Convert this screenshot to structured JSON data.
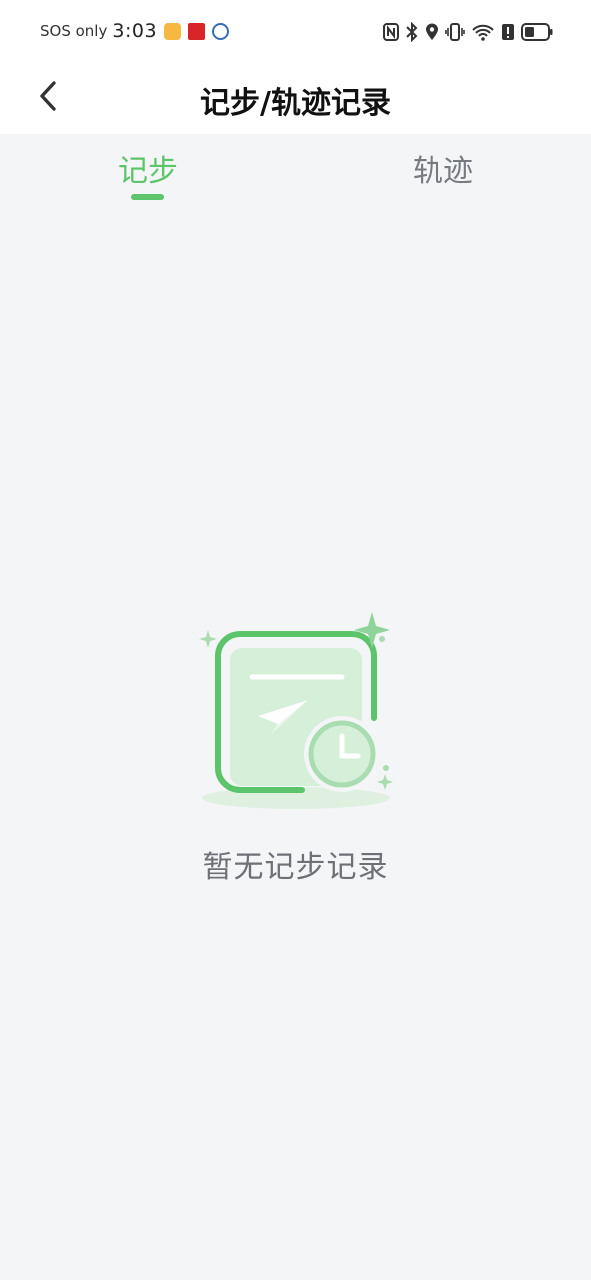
{
  "status_bar": {
    "network_text": "SOS only",
    "time": "3:03",
    "icons": [
      "notes-app-icon",
      "news-app-icon",
      "security-app-icon",
      "nfc-icon",
      "bluetooth-icon",
      "location-icon",
      "vibrate-icon",
      "wifi-icon",
      "alert-icon",
      "battery-icon"
    ]
  },
  "header": {
    "back_icon": "chevron-left-icon",
    "title": "记步/轨迹记录"
  },
  "tabs": [
    {
      "label": "记步",
      "active": true
    },
    {
      "label": "轨迹",
      "active": false
    }
  ],
  "empty_state": {
    "illustration": "empty-record-illustration",
    "message": "暂无记步记录"
  },
  "colors": {
    "accent": "#5cc46a",
    "inactive_tab": "#777b80",
    "background": "#f4f5f7"
  }
}
